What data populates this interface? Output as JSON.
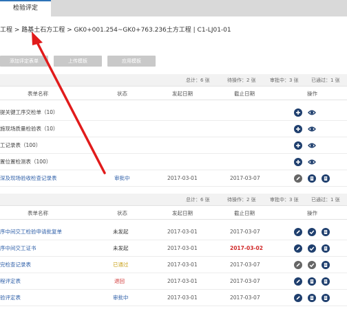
{
  "tab": {
    "label": "检验评定"
  },
  "breadcrumb": {
    "text": "工程 > 路基土石方工程 > GK0+001.254~GK0+763.236土方工程 | C1-LJ01-01"
  },
  "buttons": {
    "add": "添加评定表单",
    "upload": "上传模板",
    "apply": "应用模板"
  },
  "table1": {
    "stats": {
      "total": "总计：6 张",
      "pending": "待操作：2 张",
      "reviewing": "审批中：3 张",
      "passed": "已通过：1 张"
    },
    "headers": {
      "name": "表单名称",
      "status": "状态",
      "start": "发起日期",
      "end": "截止日期",
      "ops": "操作"
    },
    "rows": [
      {
        "name": "提关键工序交检单（10）",
        "status": "",
        "start": "",
        "end": ""
      },
      {
        "name": "施现场质量检验表（10）",
        "status": "",
        "start": "",
        "end": ""
      },
      {
        "name": "工记录表（100）",
        "status": "",
        "start": "",
        "end": ""
      },
      {
        "name": "置位置检测表（100）",
        "status": "",
        "start": "",
        "end": ""
      },
      {
        "name": "深及现场验收检查记录表",
        "status": "审批中",
        "start": "2017-03-01",
        "end": "2017-03-07"
      }
    ]
  },
  "table2": {
    "stats": {
      "total": "总计：6 张",
      "pending": "待操作：2 张",
      "reviewing": "审批中：3 张",
      "passed": "已通过：1 张"
    },
    "headers": {
      "name": "表单名称",
      "status": "状态",
      "start": "发起日期",
      "end": "截止日期",
      "ops": "操作"
    },
    "rows": [
      {
        "name": "序中间交工检验申请批复单",
        "status": "未发起",
        "start": "2017-03-01",
        "end": "2017-03-07"
      },
      {
        "name": "序中间交工证书",
        "status": "未发起",
        "start": "2017-03-01",
        "end": "2017-03-02"
      },
      {
        "name": "完检查记录表",
        "status": "已通过",
        "start": "2017-03-01",
        "end": "2017-03-07"
      },
      {
        "name": "程评定表",
        "status": "退回",
        "start": "2017-03-01",
        "end": "2017-03-07"
      },
      {
        "name": "验评定表",
        "status": "审批中",
        "start": "2017-03-01",
        "end": "2017-03-07"
      }
    ]
  },
  "colors": {
    "icon_dark": "#1f3f6e",
    "icon_grey": "#666666",
    "review": "#2e5fa8",
    "passed": "#c9a21a",
    "rejected": "#d03030",
    "overdue": "#d02828",
    "arrow": "#e11b1b"
  },
  "icons": [
    "plus-circle-icon",
    "eye-icon",
    "edit-icon",
    "check-icon",
    "doc-icon"
  ]
}
